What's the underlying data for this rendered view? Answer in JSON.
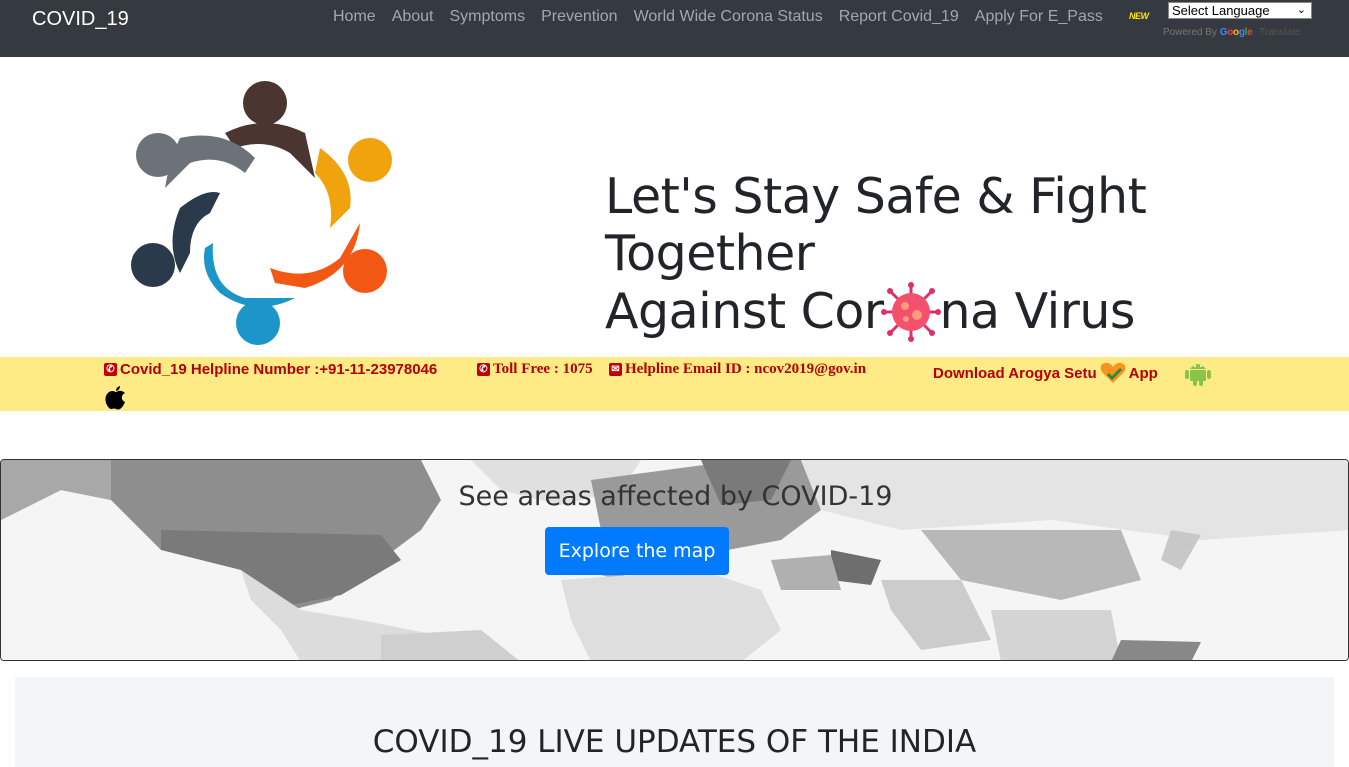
{
  "nav": {
    "brand": "COVID_19",
    "links": [
      "Home",
      "About",
      "Symptoms",
      "Prevention",
      "World Wide Corona Status",
      "Report Covid_19",
      "Apply For E_Pass"
    ],
    "new_badge": "NEW",
    "language_select": "Select Language",
    "powered_by": "Powered By",
    "google": [
      "G",
      "o",
      "o",
      "g",
      "l",
      "e"
    ],
    "translate": "Translate"
  },
  "hero": {
    "line1": "Let's Stay Safe & Fight Together",
    "line2_before": "Against Cor",
    "line2_after": "na Virus"
  },
  "helpline": {
    "number": "Covid_19 Helpline Number :+91-11-23978046",
    "toll_free": "Toll Free : 1075",
    "email": "Helpline Email ID : ncov2019@gov.in",
    "download": "Download Arogya Setu",
    "app": "App"
  },
  "map_card": {
    "title": "See areas affected by COVID-19",
    "button": "Explore the map"
  },
  "updates": {
    "title": "COVID_19 LIVE UPDATES OF THE INDIA"
  },
  "colors": {
    "navbar": "#343a40",
    "helpline_bg": "#ffeb85",
    "helpline_text": "#b30000",
    "button": "#007bff"
  }
}
